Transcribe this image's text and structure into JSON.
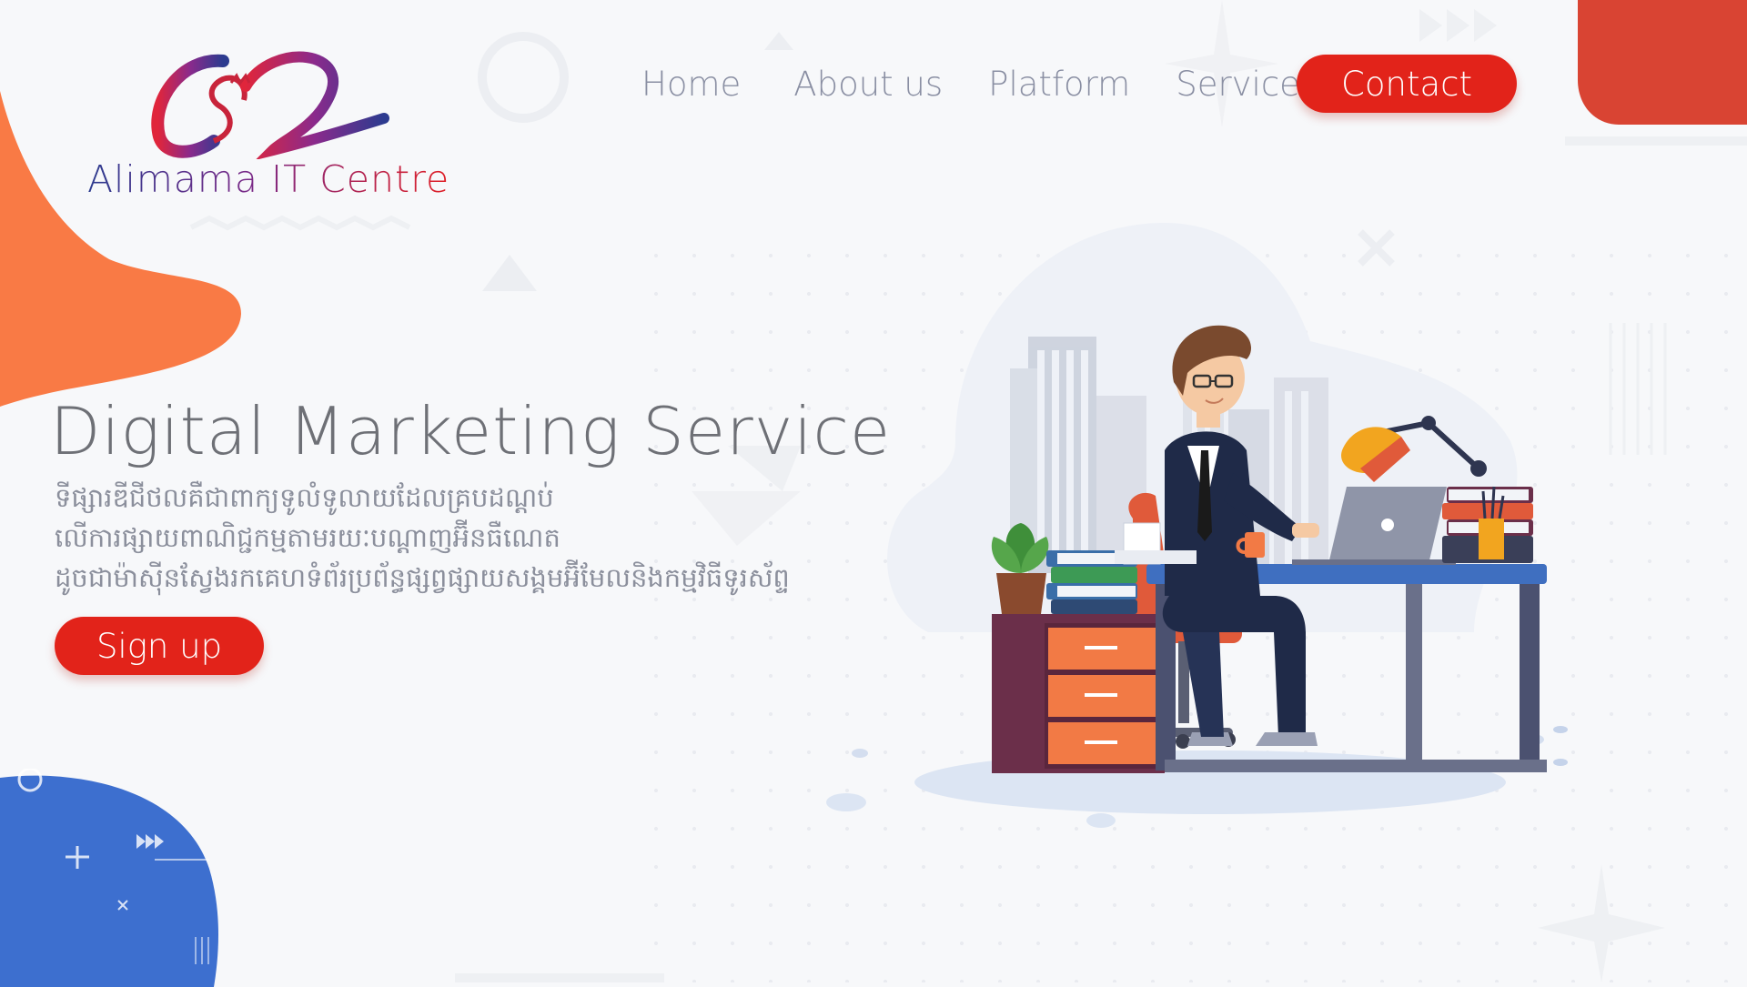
{
  "brand": {
    "name": "Alimama IT Centre",
    "accent": "#e2231a",
    "blob_orange": "#f97a45",
    "blob_blue": "#3d6fcf"
  },
  "nav": {
    "items": [
      {
        "label": "Home"
      },
      {
        "label": "About us"
      },
      {
        "label": "Platform"
      },
      {
        "label": "Services"
      }
    ],
    "contact_label": "Contact"
  },
  "hero": {
    "title": "Digital Marketing Service",
    "subtitle_lines": [
      "ទីផ្សារឌីជីថលគឺជាពាក្យទូលំទូលាយដែលគ្របដណ្តប់",
      "លើការផ្សាយពាណិជ្ជកម្មតាមរយៈបណ្តាញអ៊ីនធឺណេត",
      "ដូចជាម៉ាស៊ីនស្វែងរកគេហទំព័រប្រព័ន្ធផ្សព្វផ្សាយសង្គមអ៊ីមែលនិងកម្មវិធីទូរស័ព្ទ"
    ],
    "signup_label": "Sign up"
  },
  "illustration": {
    "subject": "man working at desk with laptop",
    "icons": [
      "city-buildings",
      "desk-lamp",
      "plant",
      "books",
      "drawers",
      "coffee-mug"
    ]
  }
}
